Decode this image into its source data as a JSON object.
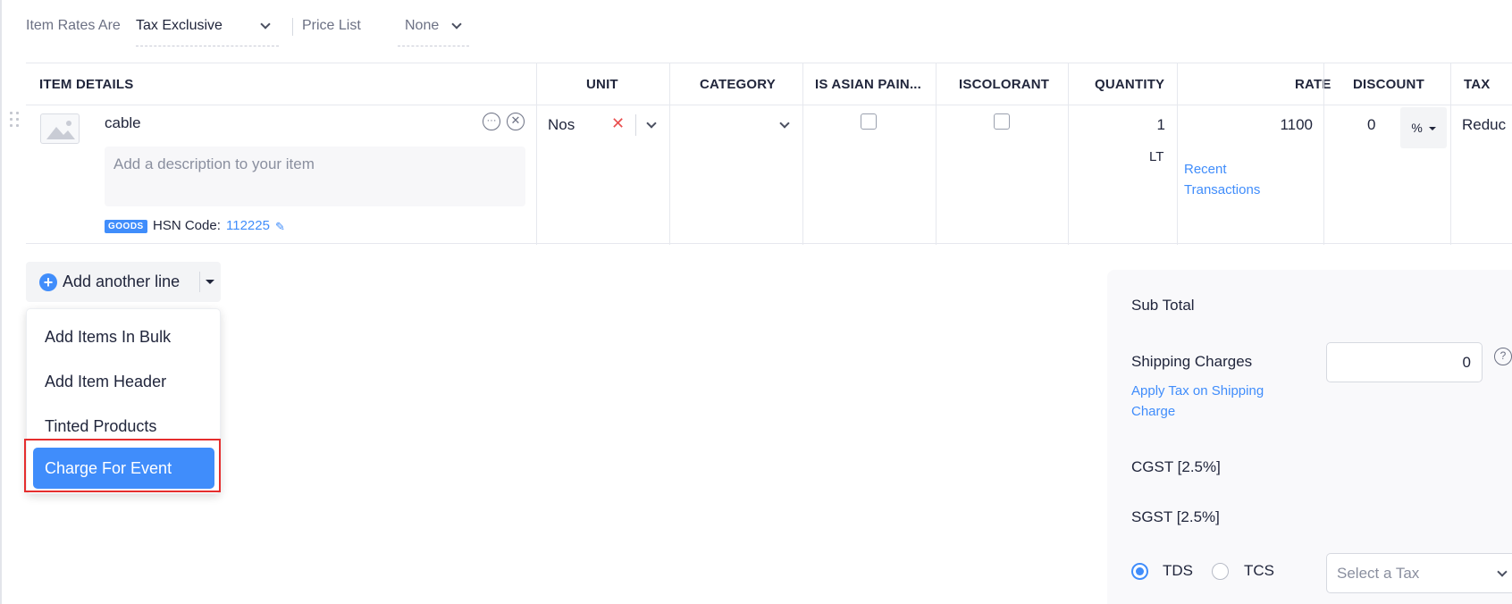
{
  "rates": {
    "item_rates_label": "Item Rates Are",
    "item_rates_value": "Tax Exclusive",
    "price_list_label": "Price List",
    "price_list_value": "None"
  },
  "table": {
    "headers": [
      "ITEM DETAILS",
      "UNIT",
      "CATEGORY",
      "IS ASIAN PAIN...",
      "ISCOLORANT",
      "QUANTITY",
      "RATE",
      "DISCOUNT",
      "TAX"
    ],
    "row": {
      "name": "cable",
      "description_placeholder": "Add a description to your item",
      "goods_badge": "GOODS",
      "hsn_label": "HSN Code:",
      "hsn_code": "112225",
      "unit": "Nos",
      "is_asian_paint": false,
      "is_colorant": false,
      "quantity": "1",
      "quantity_unit": "LT",
      "rate": "1100",
      "recent_transactions": "Recent Transactions",
      "discount": "0",
      "discount_type": "%",
      "tax": "Reduc"
    }
  },
  "add_line": {
    "label": "Add another line",
    "menu": [
      "Add Items In Bulk",
      "Add Item Header",
      "Tinted Products",
      "Charge For Event"
    ],
    "highlighted_item": "Charge For Event"
  },
  "totals": {
    "sub_total_label": "Sub Total",
    "shipping_label": "Shipping Charges",
    "shipping_value": "0",
    "apply_tax_link": "Apply Tax on Shipping Charge",
    "cgst_label": "CGST [2.5%]",
    "sgst_label": "SGST [2.5%]",
    "tds_label": "TDS",
    "tcs_label": "TCS",
    "selected_withholding": "TDS",
    "tax_select_placeholder": "Select a Tax"
  },
  "colors": {
    "accent": "#408dfb",
    "danger": "#e94f4f",
    "highlight": "#e52e2e"
  }
}
